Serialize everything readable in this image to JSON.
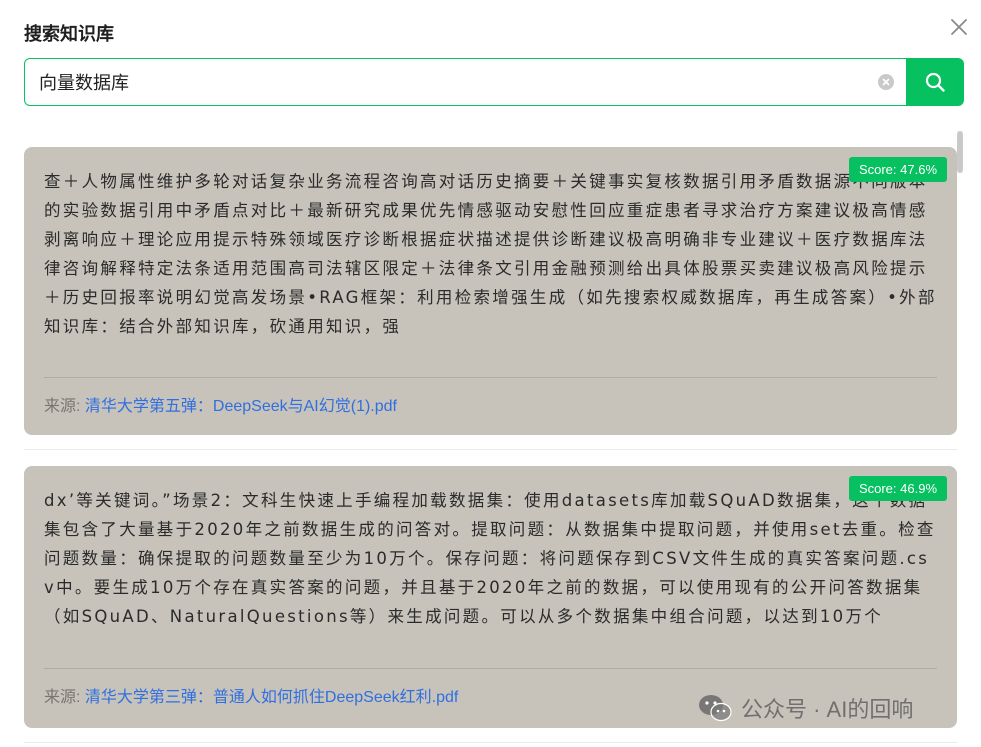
{
  "dialog": {
    "title": "搜索知识库"
  },
  "search": {
    "value": "向量数据库",
    "placeholder": ""
  },
  "results": [
    {
      "score": "Score: 47.6%",
      "text": "查＋人物属性维护多轮对话复杂业务流程咨询高对话历史摘要＋关键事实复核数据引用矛盾数据源不同版本的实验数据引用中矛盾点对比＋最新研究成果优先情感驱动安慰性回应重症患者寻求治疗方案建议极高情感剥离响应＋理论应用提示特殊领域医疗诊断根据症状描述提供诊断建议极高明确非专业建议＋医疗数据库法律咨询解释特定法条适用范围高司法辖区限定＋法律条文引用金融预测给出具体股票买卖建议极高风险提示＋历史回报率说明幻觉高发场景•RAG框架：利用检索增强生成（如先搜索权威数据库，再生成答案）•外部知识库：结合外部知识库，砍通用知识，强",
      "source_label": "来源:",
      "source_link": "清华大学第五弹：DeepSeek与AI幻觉(1).pdf"
    },
    {
      "score": "Score: 46.9%",
      "text": "dx’等关键词。”场景2：文科生快速上手编程加载数据集：使用datasets库加载SQuAD数据集，这个数据集包含了大量基于2020年之前数据生成的问答对。提取问题：从数据集中提取问题，并使用set去重。检查问题数量：确保提取的问题数量至少为10万个。保存问题：将问题保存到CSV文件生成的真实答案问题.csv中。要生成10万个存在真实答案的问题，并且基于2020年之前的数据，可以使用现有的公开问答数据集（如SQuAD、NaturalQuestions等）来生成问题。可以从多个数据集中组合问题，以达到10万个",
      "source_label": "来源:",
      "source_link": "清华大学第三弹：普通人如何抓住DeepSeek红利.pdf"
    }
  ],
  "watermark": {
    "text": "公众号 · AI的回响"
  },
  "colors": {
    "accent": "#07c160",
    "card_bg": "#c7c3bb",
    "link": "#2f6fe0"
  },
  "icons": {
    "close": "close-icon",
    "clear": "clear-icon",
    "search": "search-icon",
    "wechat": "wechat-icon"
  }
}
